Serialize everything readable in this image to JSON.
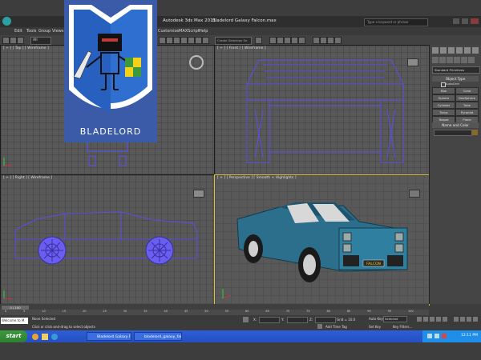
{
  "app": {
    "title_prefix": "Autodesk 3ds Max 2011",
    "filename": "Bladelord Galaxy Falcon.max",
    "search_placeholder": "Type a keyword or phrase"
  },
  "menu": [
    "Edit",
    "Tools",
    "Group",
    "Views",
    "Customize",
    "MAXScript",
    "Help"
  ],
  "toolbar": {
    "selection_filter": "All",
    "named_selection_placeholder": "Create Selection Se"
  },
  "viewports": {
    "top": "[ + ] [ Top ] [ Wireframe ]",
    "front": "[ + ] [ Front ] [ Wireframe ]",
    "right": "[ + ] [ Right ] [ Wireframe ]",
    "perspective": "[ + ] [ Perspective ] [ Smooth + Highlights ]"
  },
  "car": {
    "license_plate": "FALCON"
  },
  "logo": {
    "text": "BLADELORD"
  },
  "command_panel": {
    "dropdown": "Standard Primitives",
    "object_type_title": "Object Type",
    "autogrid": "AutoGrid",
    "buttons": [
      "Box",
      "Cone",
      "Sphere",
      "GeoSphere",
      "Cylinder",
      "Tube",
      "Torus",
      "Pyramid",
      "Teapot",
      "Plane"
    ],
    "name_color_title": "Name and Color"
  },
  "timeline": {
    "frame_counter": "0 / 100",
    "ticks": [
      "0",
      "5",
      "10",
      "15",
      "20",
      "25",
      "30",
      "35",
      "40",
      "45",
      "50",
      "55",
      "60",
      "65",
      "70",
      "75",
      "80",
      "85",
      "90",
      "95",
      "100"
    ]
  },
  "status": {
    "welcome": "Welcome to M",
    "none_selected": "None Selected",
    "prompt": "Click or click-and-drag to select objects",
    "grid": "Grid = 10.0",
    "add_time_tag": "Add Time Tag",
    "auto_key": "Auto Key",
    "set_key": "Set Key",
    "selected_dropdown": "Selected",
    "key_filters": "Key Filters...",
    "x_label": "X:",
    "y_label": "Y:",
    "z_label": "Z:"
  },
  "taskbar": {
    "start": "start",
    "tasks": [
      "Bladelord Galaxy Falc...",
      "bladelord_galaxy_fal..."
    ],
    "clock": "12:11 PM"
  },
  "colors": {
    "wire": "#5b4fe3",
    "viewport_bg": "#595959",
    "car_body": "#2b6f8c",
    "logo_bg": "#3b5aa8"
  }
}
